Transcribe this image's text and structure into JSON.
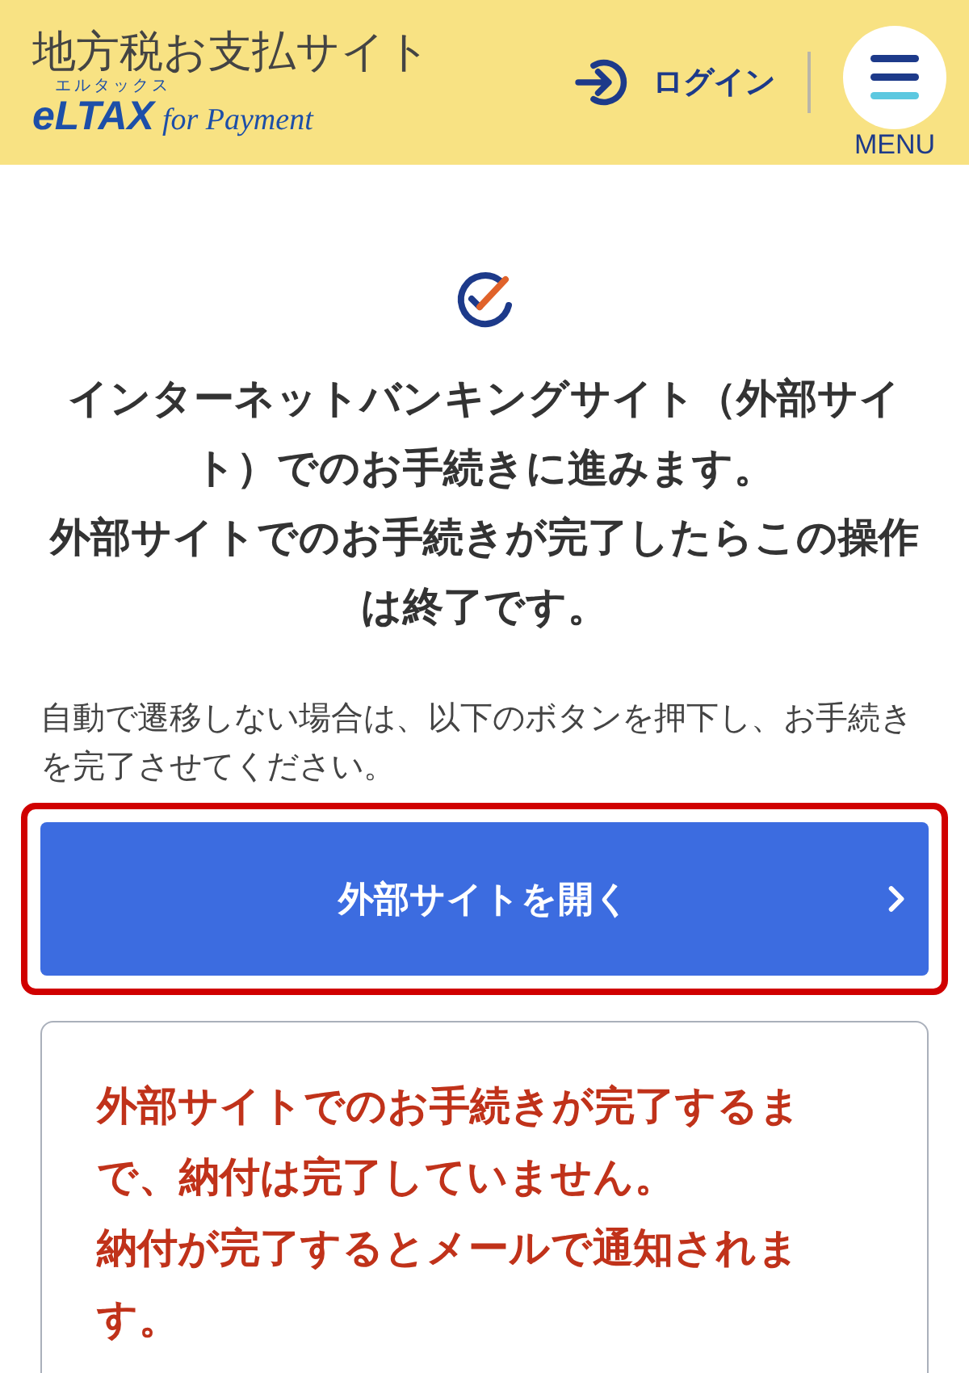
{
  "header": {
    "site_title": "地方税お支払サイト",
    "logo": {
      "ruby": "エルタックス",
      "brand": "eLTAX",
      "suffix": "for Payment"
    },
    "login": "ログイン",
    "menu": "MENU"
  },
  "main": {
    "heading": [
      "インターネットバンキングサイト（外部サイト）でのお手続きに進みます。",
      "外部サイトでのお手続きが完了したらこの操作は終了です。"
    ],
    "hint": "自動で遷移しない場合は、以下のボタンを押下し、お手続きを完了させてください。",
    "open_button": {
      "label": "外部サイトを開く",
      "highlighted": true
    },
    "notice": [
      "外部サイトでのお手続きが完了するまで、納付は完了していません。",
      "納付が完了するとメールで通知されます。"
    ]
  }
}
